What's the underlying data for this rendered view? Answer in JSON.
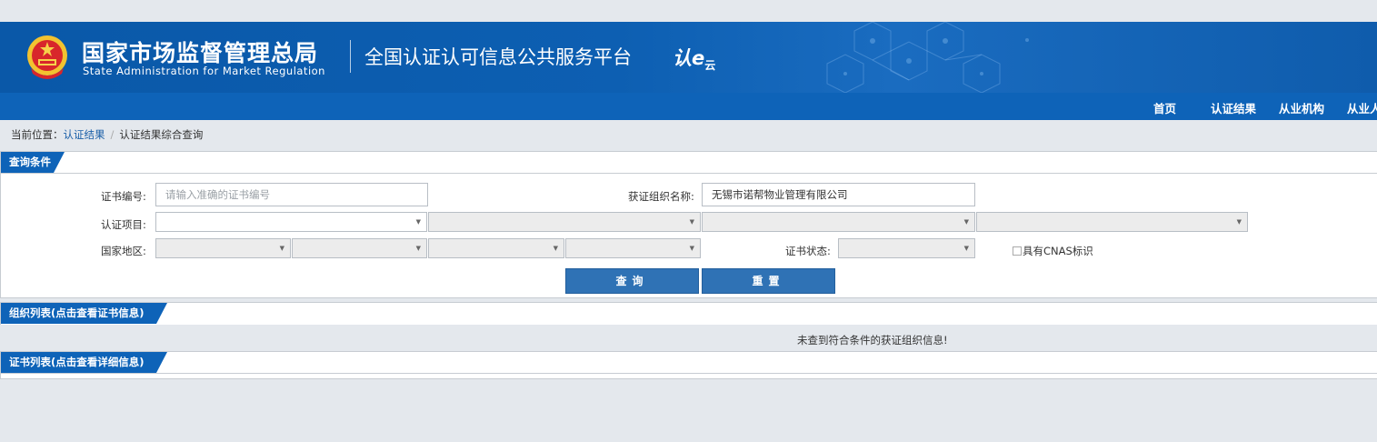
{
  "header": {
    "org_cn": "国家市场监督管理总局",
    "org_en": "State Administration  for  Market Regulation",
    "platform": "全国认证认可信息公共服务平台",
    "cloud_logo_main": "认e",
    "cloud_logo_sub": "云",
    "bg_color": "#0d5fb2"
  },
  "nav": {
    "items": [
      "首页",
      "认证结果",
      "从业机构",
      "从业人"
    ]
  },
  "breadcrumb": {
    "prefix": "当前位置：",
    "link": "认证结果",
    "separator": "/",
    "current": "认证结果综合查询"
  },
  "query": {
    "title": "查询条件",
    "cert_no_label": "证书编号:",
    "cert_no_placeholder": "请输入准确的证书编号",
    "org_name_label": "获证组织名称:",
    "org_name_value": "无锡市诺帮物业管理有限公司",
    "project_label": "认证项目:",
    "region_label": "国家地区:",
    "status_label": "证书状态:",
    "cnas_label": "具有CNAS标识",
    "search_button": "查询",
    "reset_button": "重置"
  },
  "org_list": {
    "title": "组织列表(点击查看证书信息)",
    "empty_message": "未查到符合条件的获证组织信息!"
  },
  "cert_list": {
    "title": "证书列表(点击查看详细信息)"
  },
  "colors": {
    "accent": "#0e63b8",
    "button": "#2f72b5",
    "page_bg": "#e4e8ed"
  }
}
